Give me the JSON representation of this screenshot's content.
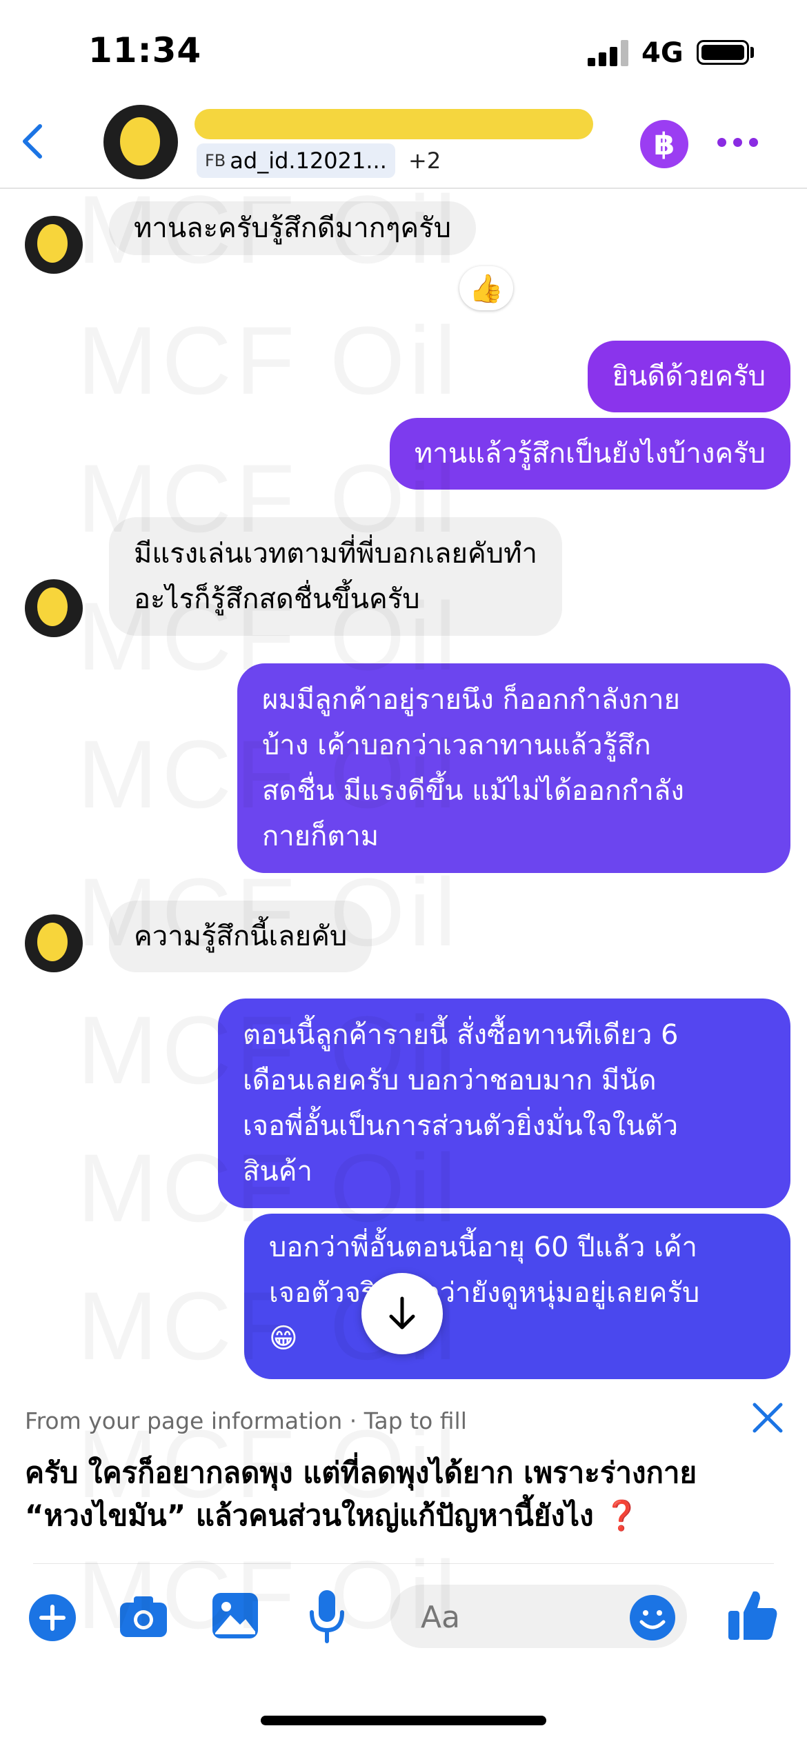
{
  "status_bar": {
    "time": "11:34",
    "network": "4G"
  },
  "header": {
    "tag_prefix": "FB",
    "tag": "ad_id.12021...",
    "more_count": "+2",
    "coin_symbol": "฿"
  },
  "watermark": "MCF Oil",
  "messages": [
    {
      "side": "in",
      "lines": [
        "ทานละครับรู้สึกดีมากๆครับ"
      ],
      "reaction": "👍"
    },
    {
      "side": "out",
      "lines": [
        "ยินดีด้วยครับ"
      ]
    },
    {
      "side": "out",
      "lines": [
        "ทานแล้วรู้สึกเป็นยังไงบ้างครับ"
      ]
    },
    {
      "side": "in",
      "lines": [
        "มีแรงเล่นเวทตามที่พี่บอกเลยคับทำ",
        "อะไรก็รู้สึกสดชื่นขึ้นครับ"
      ]
    },
    {
      "side": "out",
      "lines": [
        "ผมมีลูกค้าอยู่รายนึง ก็ออกกำลังกาย",
        "บ้าง เค้าบอกว่าเวลาทานแล้วรู้สึก",
        "สดชื่น มีแรงดีขึ้น แม้ไม่ได้ออกกำลัง",
        "กายก็ตาม"
      ]
    },
    {
      "side": "in",
      "lines": [
        "ความรู้สึกนี้เลยคับ"
      ]
    },
    {
      "side": "out",
      "lines": [
        "ตอนนี้ลูกค้ารายนี้ สั่งซื้อทานทีเดียว 6",
        "เดือนเลยครับ บอกว่าชอบมาก มีนัด",
        "เจอพี่อั้นเป็นการส่วนตัวยิ่งมั่นใจในตัว",
        "สินค้า"
      ]
    },
    {
      "side": "out",
      "lines": [
        "บอกว่าพี่อั้นตอนนี้อายุ 60 ปีแล้ว เค้า",
        "เจอตัวจริงบอกว่ายังดูหนุ่มอยู่เลยครับ",
        "😁"
      ]
    }
  ],
  "suggestion": {
    "hint": "From your page information · Tap to fill",
    "line1": "ครับ ใครก็อยากลดพุง แต่ที่ลดพุงได้ยาก เพราะร่างกาย",
    "line2": "“หวงไขมัน” แล้วคนส่วนใหญ่แก้ปัญหานี้ยังไง",
    "emoji": "❓"
  },
  "composer": {
    "placeholder": "Aa"
  },
  "colors": {
    "accent": "#4a48ee",
    "purple": "#8a34ec",
    "incoming_bg": "#f0f0f0",
    "thumb": "#1877f2"
  },
  "icons": [
    "back-icon",
    "more-icon",
    "coin-icon",
    "plus-icon",
    "camera-icon",
    "image-icon",
    "mic-icon",
    "emoji-icon",
    "thumbs-up-icon",
    "close-icon",
    "arrow-down-icon"
  ]
}
